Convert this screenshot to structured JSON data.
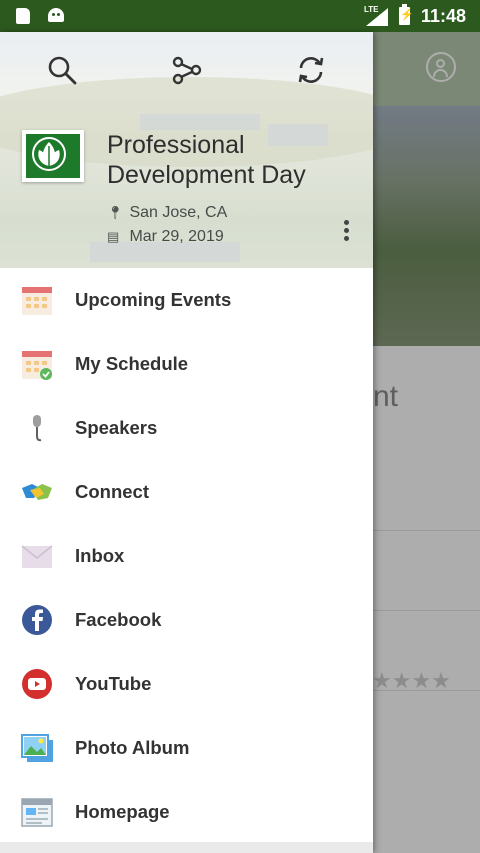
{
  "status_bar": {
    "network": "LTE",
    "time": "11:48"
  },
  "drawer": {
    "event_title": "Professional Development Day",
    "location": "San Jose, CA",
    "date": "Mar 29, 2019",
    "menu_items": [
      {
        "label": "Upcoming Events",
        "icon": "calendar-icon"
      },
      {
        "label": "My Schedule",
        "icon": "calendar-check-icon"
      },
      {
        "label": "Speakers",
        "icon": "microphone-icon"
      },
      {
        "label": "Connect",
        "icon": "handshake-icon"
      },
      {
        "label": "Inbox",
        "icon": "envelope-icon"
      },
      {
        "label": "Facebook",
        "icon": "facebook-icon"
      },
      {
        "label": "YouTube",
        "icon": "youtube-icon"
      },
      {
        "label": "Photo Album",
        "icon": "photo-album-icon"
      },
      {
        "label": "Homepage",
        "icon": "homepage-icon"
      }
    ]
  },
  "background": {
    "title_fragment": "nt",
    "rating_stars": "★★★★"
  },
  "colors": {
    "status_bar": "#2c5a1e",
    "brand_green": "#1d7a2a",
    "facebook_blue": "#3b5998",
    "youtube_red": "#d32f2f"
  }
}
